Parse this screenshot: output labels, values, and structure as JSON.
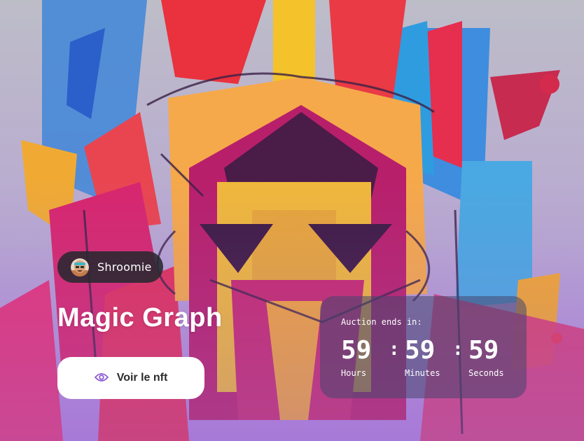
{
  "nft": {
    "creator": "Shroomie",
    "title": "Magic Graph",
    "view_button_label": "Voir le nft",
    "view_icon": "eye-icon"
  },
  "auction": {
    "label": "Auction ends in:",
    "hours": "59",
    "minutes": "59",
    "seconds": "59",
    "hours_label": "Hours",
    "minutes_label": "Minutes",
    "seconds_label": "Seconds",
    "separator": ":"
  },
  "colors": {
    "accent": "#8e5bd6",
    "panel": "#46466e",
    "chip": "#28282f"
  }
}
